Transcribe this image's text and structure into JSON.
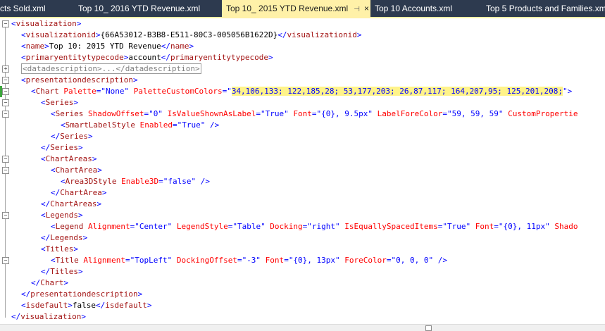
{
  "tabs": [
    {
      "label": "cts Sold.xml",
      "active": false
    },
    {
      "label": "Top 10_ 2016 YTD Revenue.xml",
      "active": false
    },
    {
      "label": "Top 10_ 2015 YTD Revenue.xml",
      "active": true,
      "pin_icon": "pin-icon",
      "close_icon": "close-icon"
    },
    {
      "label": "Top 10 Accounts.xml",
      "active": false
    },
    {
      "label": "Top 5 Products and Families.xml",
      "active": false
    }
  ],
  "icons": {
    "pin": "⊣",
    "close": "×",
    "minus": "−",
    "plus": "+"
  },
  "code": {
    "l1": {
      "open": "<",
      "tag": "visualization",
      "close": ">"
    },
    "l2": {
      "open": "<",
      "tag": "visualizationid",
      "close": ">",
      "value": "{66A53012-B3B8-E511-80C3-005056B1622D}",
      "eopen": "</",
      "etag": "visualizationid",
      "eclose": ">"
    },
    "l3": {
      "open": "<",
      "tag": "name",
      "close": ">",
      "value": "Top 10: 2015 YTD Revenue",
      "eopen": "</",
      "etag": "name",
      "eclose": ">"
    },
    "l4": {
      "open": "<",
      "tag": "primaryentitytypecode",
      "close": ">",
      "value": "account",
      "eopen": "</",
      "etag": "primaryentitytypecode",
      "eclose": ">"
    },
    "l5": {
      "collapsed": "<datadescription>...</datadescription>"
    },
    "l6": {
      "open": "<",
      "tag": "presentationdescription",
      "close": ">"
    },
    "l7": {
      "open": "<",
      "tag": "Chart",
      "a1": " Palette",
      "eq1": "=",
      "v1": "\"None\"",
      "a2": " PaletteCustomColors",
      "eq2": "=",
      "q": "\"",
      "hl": "34,106,133; 122,185,28; 53,177,203; 26,87,117; 164,207,95; 125,201,208;",
      "qend": "\"",
      "close": ">"
    },
    "l8": {
      "open": "<",
      "tag": "Series",
      "close": ">"
    },
    "l9": {
      "open": "<",
      "tag": "Series",
      "a1": " ShadowOffset",
      "v1": "\"0\"",
      "a2": " IsValueShownAsLabel",
      "v2": "\"True\"",
      "a3": " Font",
      "v3": "\"{0}, 9.5px\"",
      "a4": " LabelForeColor",
      "v4": "\"59, 59, 59\"",
      "a5": " CustomPropertie",
      "eq": "="
    },
    "l10": {
      "open": "<",
      "tag": "SmartLabelStyle",
      "a1": " Enabled",
      "v1": "\"True\"",
      "close": " />"
    },
    "l11": {
      "open": "</",
      "tag": "Series",
      "close": ">"
    },
    "l12": {
      "open": "</",
      "tag": "Series",
      "close": ">"
    },
    "l13": {
      "open": "<",
      "tag": "ChartAreas",
      "close": ">"
    },
    "l14": {
      "open": "<",
      "tag": "ChartArea",
      "close": ">"
    },
    "l15": {
      "open": "<",
      "tag": "Area3DStyle",
      "a1": " Enable3D",
      "v1": "\"false\"",
      "close": " />"
    },
    "l16": {
      "open": "</",
      "tag": "ChartArea",
      "close": ">"
    },
    "l17": {
      "open": "</",
      "tag": "ChartAreas",
      "close": ">"
    },
    "l18": {
      "open": "<",
      "tag": "Legends",
      "close": ">"
    },
    "l19": {
      "open": "<",
      "tag": "Legend",
      "a1": " Alignment",
      "v1": "\"Center\"",
      "a2": " LegendStyle",
      "v2": "\"Table\"",
      "a3": " Docking",
      "v3": "\"right\"",
      "a4": " IsEquallySpacedItems",
      "v4": "\"True\"",
      "a5": " Font",
      "v5": "\"{0}, 11px\"",
      "a6": " Shado"
    },
    "l20": {
      "open": "</",
      "tag": "Legends",
      "close": ">"
    },
    "l21": {
      "open": "<",
      "tag": "Titles",
      "close": ">"
    },
    "l22": {
      "open": "<",
      "tag": "Title",
      "a1": " Alignment",
      "v1": "\"TopLeft\"",
      "a2": " DockingOffset",
      "v2": "\"-3\"",
      "a3": " Font",
      "v3": "\"{0}, 13px\"",
      "a4": " ForeColor",
      "v4": "\"0, 0, 0\"",
      "close": " />"
    },
    "l23": {
      "open": "</",
      "tag": "Titles",
      "close": ">"
    },
    "l24": {
      "open": "</",
      "tag": "Chart",
      "close": ">"
    },
    "l25": {
      "open": "</",
      "tag": "presentationdescription",
      "close": ">"
    },
    "l26": {
      "open": "<",
      "tag": "isdefault",
      "close": ">",
      "value": "false",
      "eopen": "</",
      "etag": "isdefault",
      "eclose": ">"
    },
    "l27": {
      "open": "</",
      "tag": "visualization",
      "close": ">"
    }
  },
  "colors": {
    "tabbar": "#2d3a4f",
    "active_tab": "#fff1a8",
    "highlight": "#fff38a",
    "tag": "#a31515",
    "attr": "#ff0000",
    "value": "#0000ff"
  }
}
